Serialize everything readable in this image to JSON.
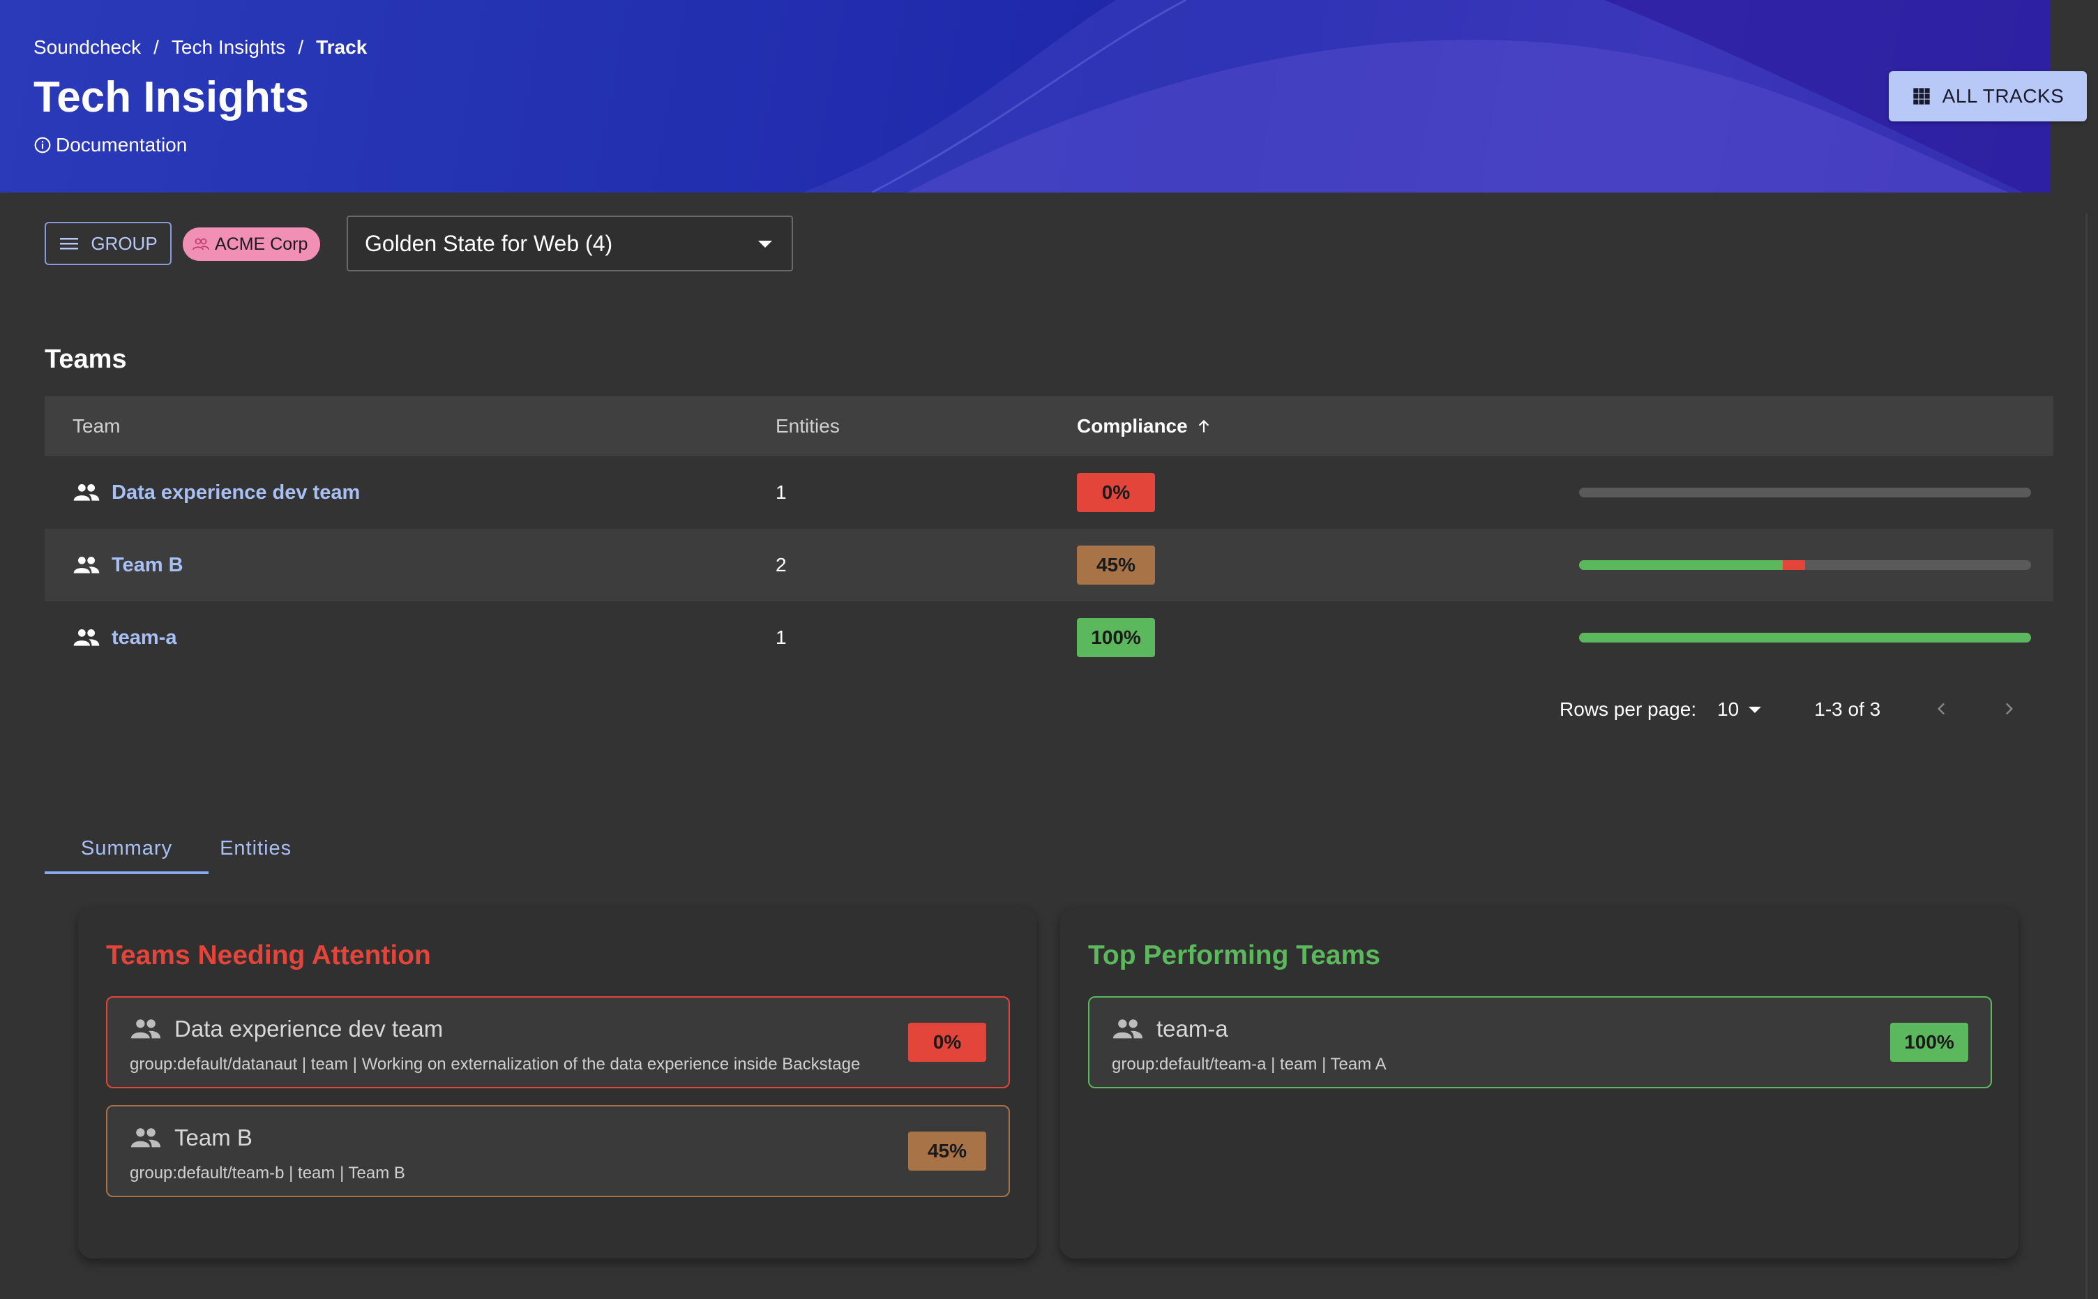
{
  "breadcrumb": [
    "Soundcheck",
    "Tech Insights",
    "Track"
  ],
  "header": {
    "title": "Tech Insights",
    "documentation": "Documentation",
    "all_tracks": "ALL TRACKS"
  },
  "controls": {
    "group_label": "GROUP",
    "chip_label": "ACME Corp",
    "track_select": "Golden State for Web (4)"
  },
  "teams": {
    "title": "Teams",
    "columns": {
      "team": "Team",
      "entities": "Entities",
      "compliance": "Compliance"
    },
    "rows": [
      {
        "name": "Data experience dev team",
        "entities": "1",
        "compliance": "0%",
        "status": "red",
        "pass_pct": 0,
        "fail_pct": 0
      },
      {
        "name": "Team B",
        "entities": "2",
        "compliance": "45%",
        "status": "amber",
        "pass_pct": 45,
        "fail_pct": 5
      },
      {
        "name": "team-a",
        "entities": "1",
        "compliance": "100%",
        "status": "green",
        "pass_pct": 100,
        "fail_pct": 0
      }
    ],
    "pagination": {
      "rows_per_page_label": "Rows per page:",
      "rows_per_page": "10",
      "range": "1-3 of 3"
    }
  },
  "tabs": [
    "Summary",
    "Entities"
  ],
  "attention": {
    "title": "Teams Needing Attention",
    "cards": [
      {
        "name": "Data experience dev team",
        "meta": "group:default/datanaut | team | Working on externalization of the data experience inside Backstage",
        "compliance": "0%"
      },
      {
        "name": "Team B",
        "meta": "group:default/team-b | team | Team B",
        "compliance": "45%"
      }
    ]
  },
  "top": {
    "title": "Top Performing Teams",
    "cards": [
      {
        "name": "team-a",
        "meta": "group:default/team-a | team | Team A",
        "compliance": "100%"
      }
    ]
  },
  "colors": {
    "red": "#e4453a",
    "amber": "#a87447",
    "green": "#5cb85c",
    "accent": "#a8c0f5"
  }
}
